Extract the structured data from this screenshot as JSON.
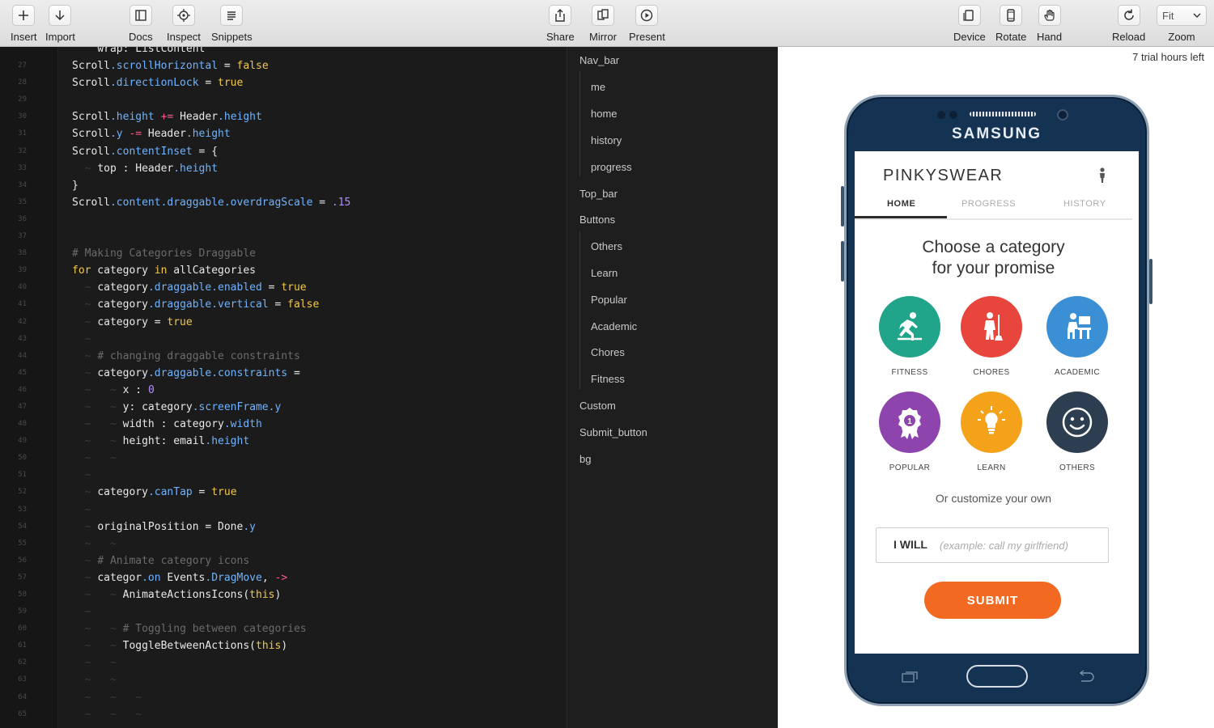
{
  "toolbar": {
    "insert_label": "Insert",
    "import_label": "Import",
    "docs_label": "Docs",
    "inspect_label": "Inspect",
    "snippets_label": "Snippets",
    "share_label": "Share",
    "mirror_label": "Mirror",
    "present_label": "Present",
    "device_label": "Device",
    "rotate_label": "Rotate",
    "hand_label": "Hand",
    "reload_label": "Reload",
    "zoom_label": "Zoom",
    "zoom_value": "Fit"
  },
  "editor": {
    "line_numbers": [
      "27",
      "28",
      "29",
      "30",
      "31",
      "32",
      "33",
      "34",
      "35",
      "36",
      "37",
      "38",
      "39",
      "40",
      "41",
      "42",
      "43",
      "44",
      "45",
      "46",
      "47",
      "48",
      "49",
      "50",
      "51",
      "52",
      "53",
      "54",
      "55",
      "56",
      "57",
      "58",
      "59",
      "60",
      "61",
      "62",
      "63",
      "64",
      "65"
    ]
  },
  "layers": {
    "items": [
      {
        "label": "Nav_bar"
      },
      {
        "label": "me"
      },
      {
        "label": "home"
      },
      {
        "label": "history"
      },
      {
        "label": "progress"
      },
      {
        "label": "Top_bar"
      },
      {
        "label": "Buttons"
      },
      {
        "label": "Others"
      },
      {
        "label": "Learn"
      },
      {
        "label": "Popular"
      },
      {
        "label": "Academic"
      },
      {
        "label": "Chores"
      },
      {
        "label": "Fitness"
      },
      {
        "label": "Custom"
      },
      {
        "label": "Submit_button"
      },
      {
        "label": "bg"
      }
    ]
  },
  "preview": {
    "trial_text": "7 trial hours left",
    "device_brand": "SAMSUNG"
  },
  "app": {
    "title": "PINKYSWEAR",
    "tabs": [
      {
        "label": "HOME"
      },
      {
        "label": "PROGRESS"
      },
      {
        "label": "HISTORY"
      }
    ],
    "headline_1": "Choose a category",
    "headline_2": "for your promise",
    "categories": [
      {
        "label": "FITNESS",
        "color": "#20a58a",
        "icon": "fitness-icon"
      },
      {
        "label": "CHORES",
        "color": "#e8463c",
        "icon": "chores-icon"
      },
      {
        "label": "ACADEMIC",
        "color": "#3b8fd4",
        "icon": "academic-icon"
      },
      {
        "label": "POPULAR",
        "color": "#8e44ad",
        "icon": "popular-icon"
      },
      {
        "label": "LEARN",
        "color": "#f5a21b",
        "icon": "learn-icon"
      },
      {
        "label": "OTHERS",
        "color": "#2c3e50",
        "icon": "others-icon"
      }
    ],
    "custom_text": "Or customize your own",
    "input_prefix": "I WILL",
    "input_placeholder": "(example: call my girlfriend)",
    "submit_label": "SUBMIT"
  }
}
